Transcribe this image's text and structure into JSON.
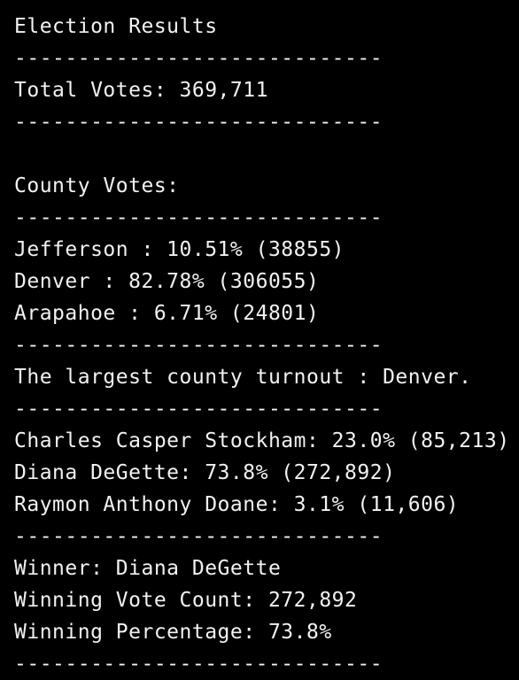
{
  "terminal": {
    "title_line": "Election Results",
    "separator": "-----------------------------",
    "total_votes": "Total Votes: 369,711",
    "county_header": "County Votes:",
    "counties": [
      "Jefferson : 10.51% (38855)",
      "Denver : 82.78% (306055)",
      "Arapahoe : 6.71% (24801)"
    ],
    "largest_county": "The largest county turnout : Denver.",
    "candidates": [
      "Charles Casper Stockham: 23.0% (85,213)",
      "Diana DeGette: 73.8% (272,892)",
      "Raymon Anthony Doane: 3.1% (11,606)"
    ],
    "winner": "Winner: Diana DeGette",
    "winning_vote_count": "Winning Vote Count: 272,892",
    "winning_percentage": "Winning Percentage: 73.8%"
  },
  "colors": {
    "background": "#000000",
    "text": "#f2f2f2"
  }
}
